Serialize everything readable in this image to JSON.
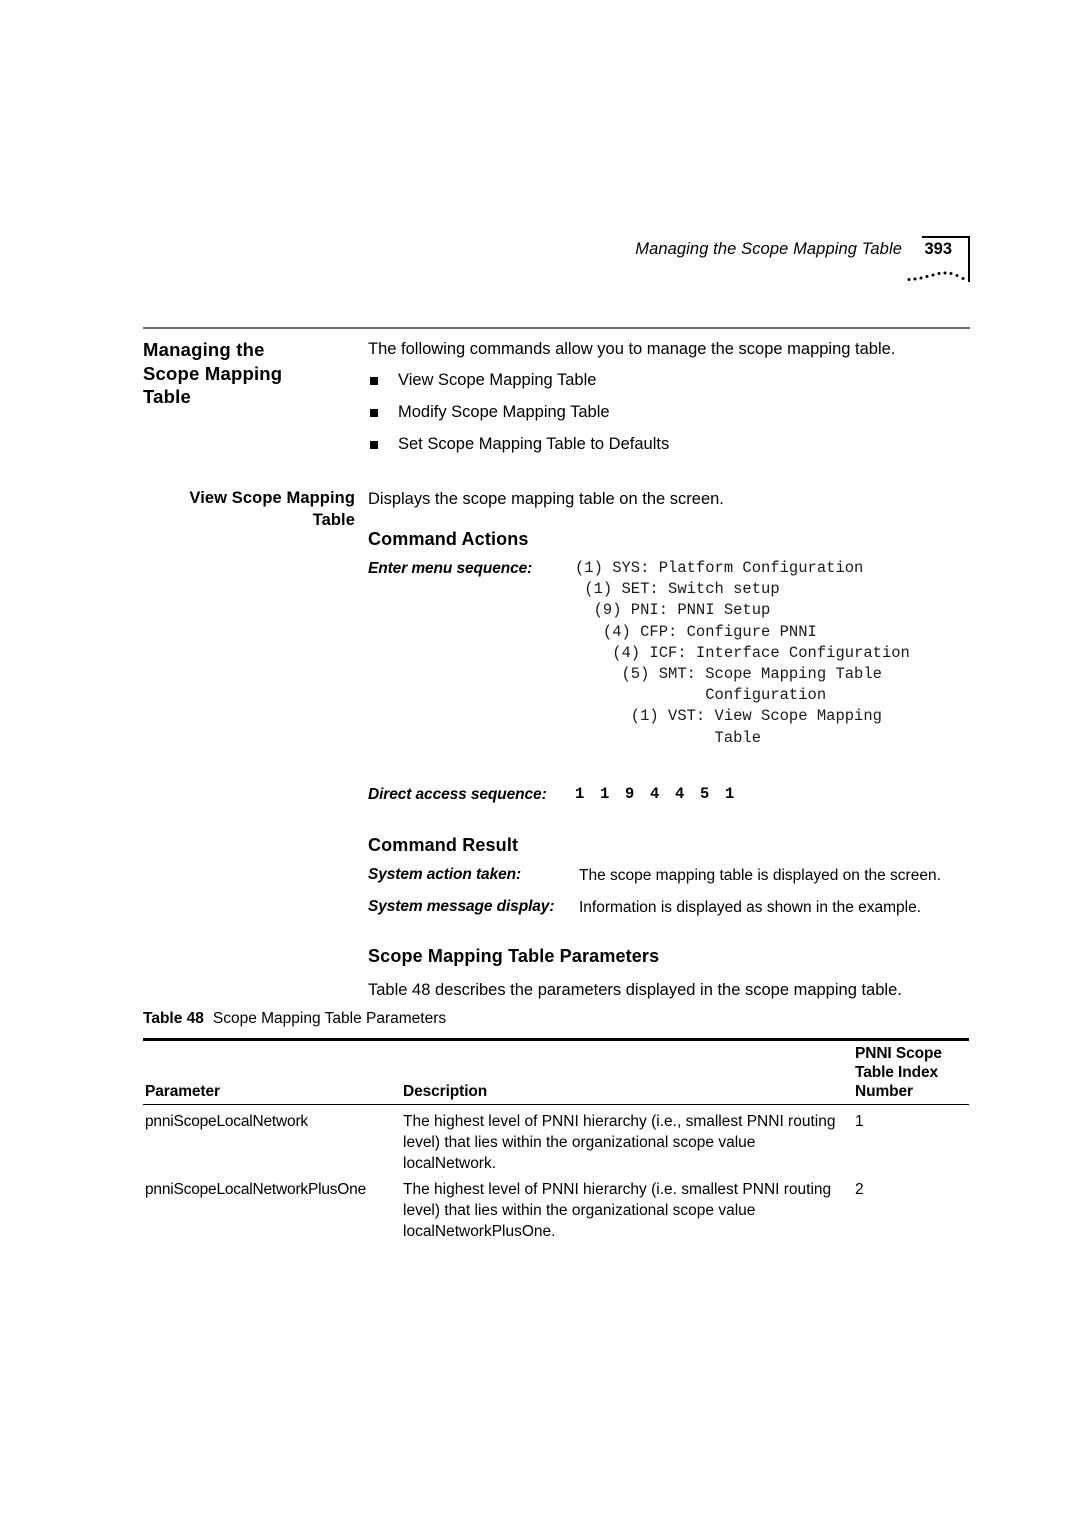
{
  "running_header": {
    "title": "Managing the Scope Mapping Table",
    "page_number": "393"
  },
  "sections": {
    "main_heading": "Managing the\nScope Mapping\nTable",
    "intro_paragraph": "The following commands allow you to manage the scope mapping table.",
    "bullets": [
      "View Scope Mapping Table",
      "Modify Scope Mapping Table",
      "Set Scope Mapping Table to Defaults"
    ],
    "sub_heading": "View Scope Mapping\nTable",
    "sub_description": "Displays the scope mapping table on the screen.",
    "command_actions_heading": "Command Actions",
    "enter_menu_label": "Enter menu sequence:",
    "menu_sequence": "(1) SYS: Platform Configuration\n (1) SET: Switch setup\n  (9) PNI: PNNI Setup\n   (4) CFP: Configure PNNI\n    (4) ICF: Interface Configuration\n     (5) SMT: Scope Mapping Table\n              Configuration\n      (1) VST: View Scope Mapping\n               Table",
    "direct_access_label": "Direct access sequence:",
    "direct_access_value": "1 1 9 4 4 5 1",
    "command_result_heading": "Command Result",
    "system_action_label": "System action taken:",
    "system_action_value": "The scope mapping table is displayed on the screen.",
    "system_message_label": "System message display:",
    "system_message_value": "Information is displayed as shown in the example.",
    "params_heading": "Scope Mapping Table Parameters",
    "params_intro": "Table 48 describes the parameters displayed in the scope mapping table."
  },
  "table": {
    "caption_label": "Table 48",
    "caption_text": "Scope Mapping Table Parameters",
    "headers": {
      "parameter": "Parameter",
      "description": "Description",
      "index": "PNNI Scope\nTable Index\nNumber"
    },
    "rows": [
      {
        "parameter": "pnniScopeLocalNetwork",
        "description": "The highest level of PNNI hierarchy (i.e., smallest PNNI routing level) that lies within the organizational scope value localNetwork.",
        "index": "1"
      },
      {
        "parameter": "pnniScopeLocalNetworkPlusOne",
        "description": "The highest level of PNNI hierarchy (i.e. smallest PNNI routing level) that lies within the organizational scope value localNetworkPlusOne.",
        "index": "2"
      }
    ]
  }
}
